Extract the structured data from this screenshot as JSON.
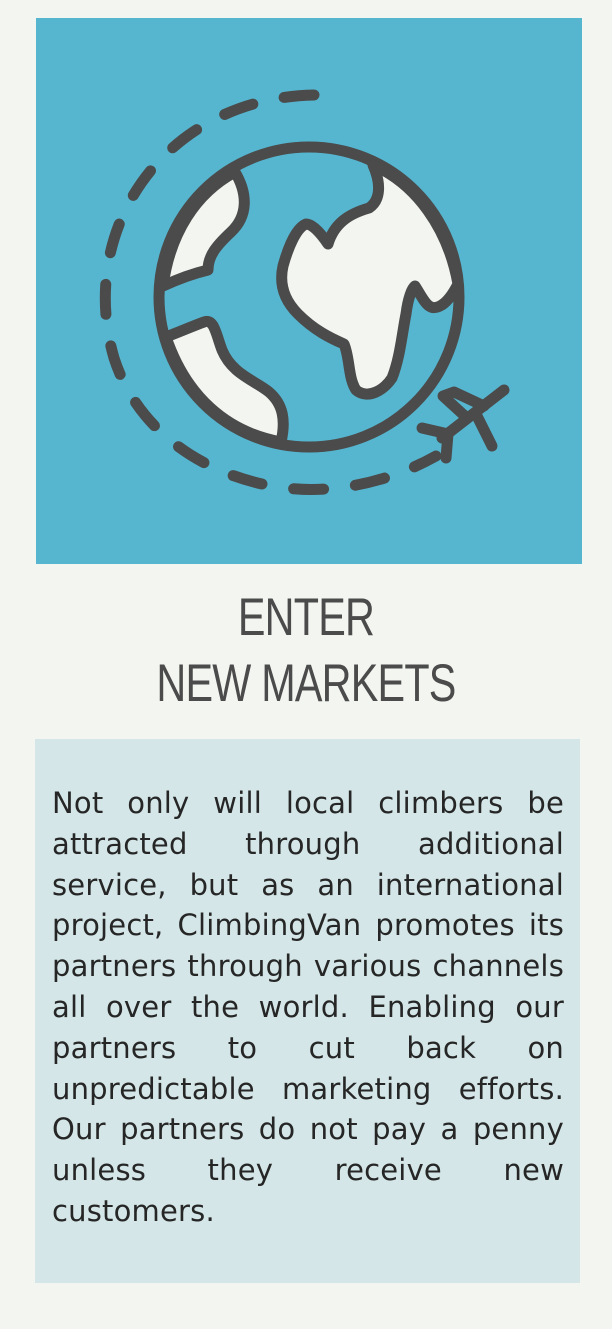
{
  "colors": {
    "page_background": "#f2f5f0",
    "icon_panel": "#56b6d0",
    "icon_stroke": "#4b4b4b",
    "land_fill": "#f2f5f0",
    "text_panel": "#d4e6e7",
    "heading_text": "#4b4b4b",
    "body_text": "#262626"
  },
  "icon": {
    "name": "globe-with-airplane-icon"
  },
  "heading": {
    "line1": "ENTER",
    "line2": "NEW MARKETS"
  },
  "body": {
    "text": "Not only will local climbers be attracted through additional service, but as an international project, ClimbingVan promotes its partners through various channels all over the world. Enabling our partners to cut back on unpredictable marketing efforts. Our partners do not pay a penny unless they receive new customers."
  }
}
